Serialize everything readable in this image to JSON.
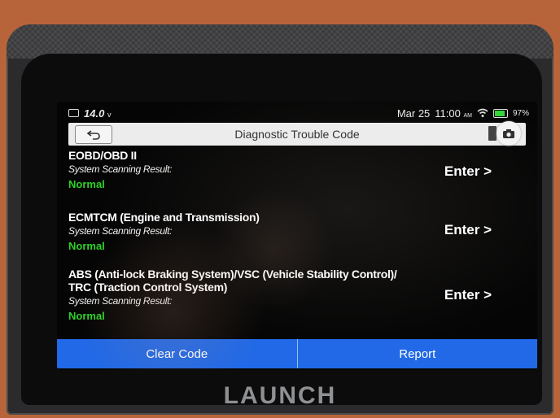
{
  "status_bar": {
    "voltage": "14.0",
    "voltage_unit": "v",
    "date": "Mar 25",
    "time": "11:00",
    "ampm": "AM",
    "battery_percent": "97%",
    "battery_level": 0.97,
    "battery_color": "#38d53a",
    "icons": [
      "camera-icon",
      "wifi-icon",
      "battery-icon"
    ]
  },
  "header": {
    "title": "Diagnostic Trouble Code",
    "icons": [
      "back-arrow-icon",
      "camera-icon"
    ]
  },
  "systems": [
    {
      "name_lines": [
        "EOBD/OBD II"
      ],
      "scan_label": "System Scanning Result:",
      "result": "Normal",
      "enter_label": "Enter >"
    },
    {
      "name_lines": [
        "ECMTCM (Engine and Transmission)"
      ],
      "scan_label": "System Scanning Result:",
      "result": "Normal",
      "enter_label": "Enter >"
    },
    {
      "name_lines": [
        "ABS (Anti-lock Braking System)/VSC (Vehicle Stability Control)/",
        "TRC (Traction Control System)"
      ],
      "scan_label": "System Scanning Result:",
      "result": "Normal",
      "enter_label": "Enter >"
    }
  ],
  "actions": {
    "clear_code": "Clear Code",
    "report": "Report"
  },
  "brand": "LAUNCH",
  "colors": {
    "accent": "#2169e6",
    "normal_status": "#2fd12a"
  }
}
